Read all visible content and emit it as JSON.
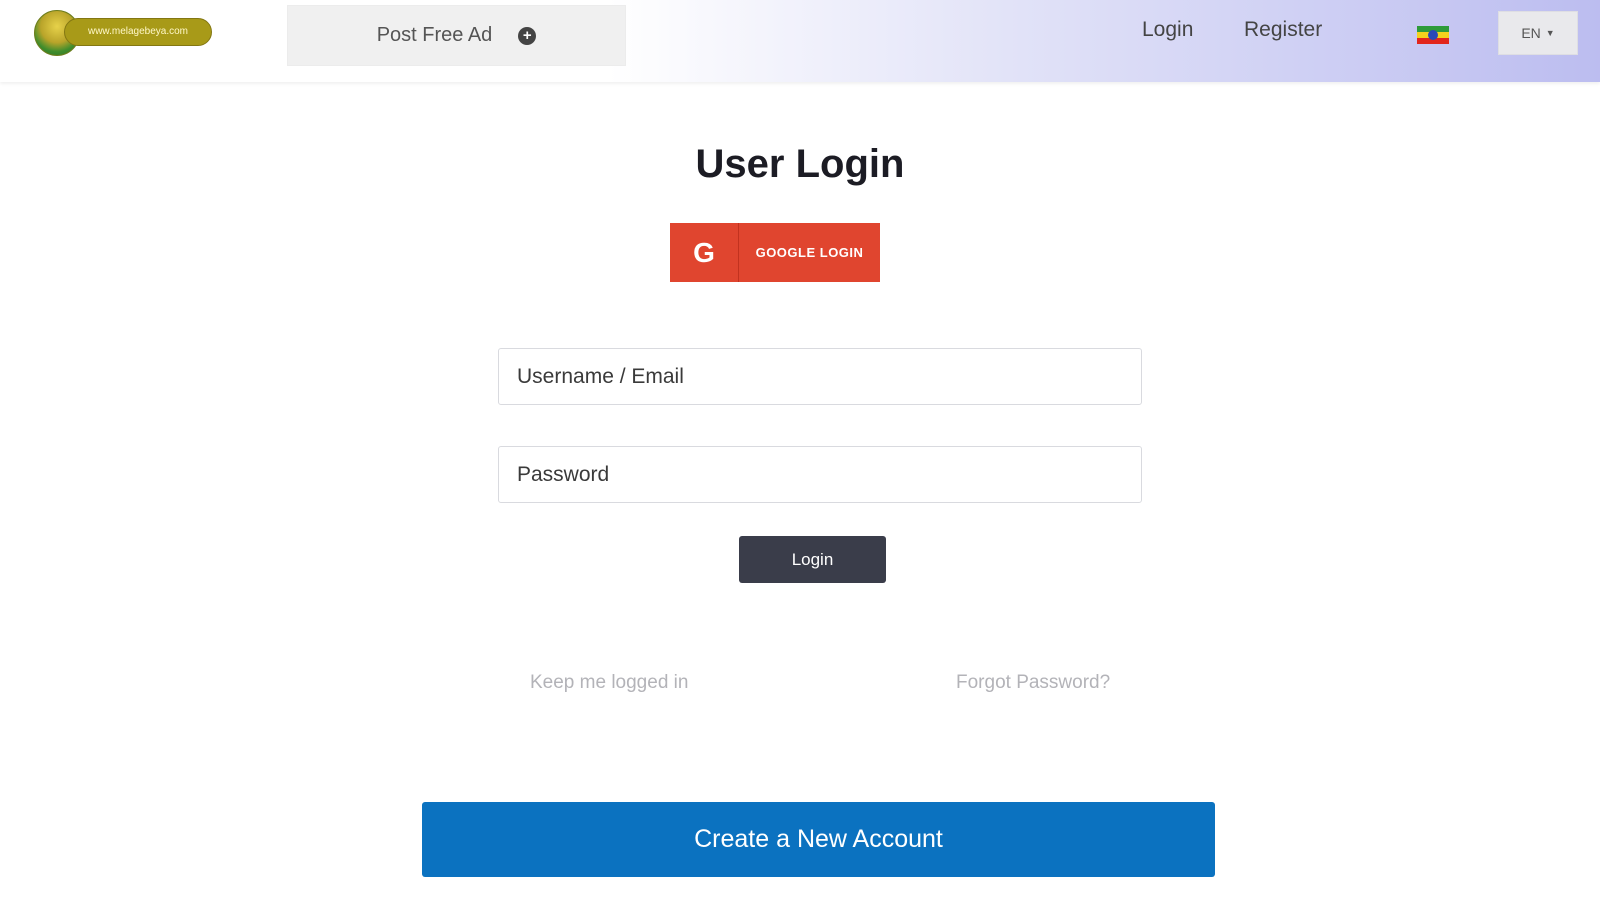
{
  "header": {
    "logo_text": "www.melagebeya.com",
    "post_ad_label": "Post Free Ad",
    "post_ad_icon": "plus-circle-icon",
    "nav": {
      "login_label": "Login",
      "register_label": "Register"
    },
    "flag_icon": "ethiopia-flag-icon",
    "language": "EN",
    "language_caret_icon": "caret-down-icon"
  },
  "main": {
    "title": "User Login",
    "google_button": {
      "icon": "google-g-icon",
      "icon_glyph": "G",
      "label": "GOOGLE LOGIN"
    },
    "username_placeholder": "Username / Email",
    "password_placeholder": "Password",
    "login_button_label": "Login",
    "keep_logged_in_label": "Keep me logged in",
    "forgot_password_label": "Forgot Password?",
    "create_account_label": "Create a New Account"
  },
  "colors": {
    "google_red": "#e0452f",
    "login_dark": "#3a3d4a",
    "create_blue": "#0b72c0",
    "header_gradient_end": "#bcbdf0"
  }
}
